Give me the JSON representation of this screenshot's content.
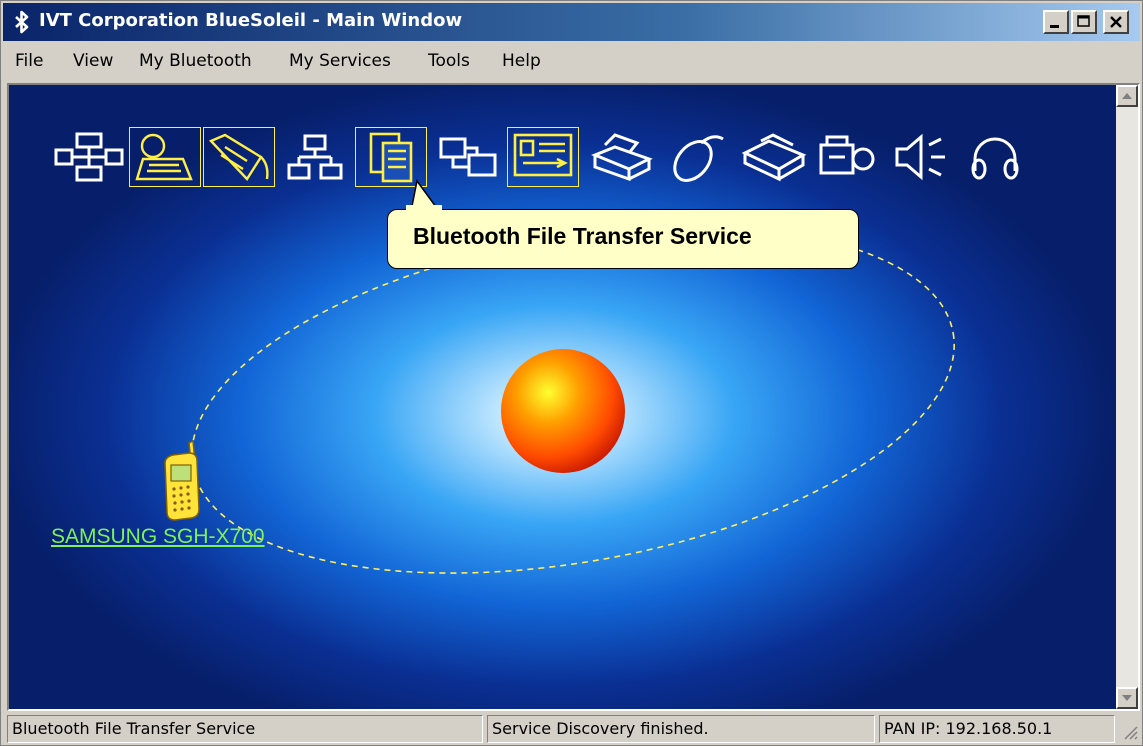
{
  "window": {
    "title": "IVT Corporation BlueSoleil - Main Window",
    "buttons": [
      "minimize",
      "maximize",
      "close"
    ]
  },
  "menu": [
    "File",
    "View",
    "My Bluetooth",
    "My Services",
    "Tools",
    "Help"
  ],
  "service_icons": [
    {
      "name": "network-access-icon",
      "highlighted": false
    },
    {
      "name": "dial-up-networking-icon",
      "highlighted": true
    },
    {
      "name": "serial-port-icon",
      "highlighted": true
    },
    {
      "name": "personal-area-network-icon",
      "highlighted": false
    },
    {
      "name": "file-transfer-icon",
      "highlighted": true
    },
    {
      "name": "synchronization-icon",
      "highlighted": false
    },
    {
      "name": "business-card-icon",
      "highlighted": true
    },
    {
      "name": "printer-icon",
      "highlighted": false
    },
    {
      "name": "mouse-icon",
      "highlighted": false
    },
    {
      "name": "fax-icon",
      "highlighted": false
    },
    {
      "name": "camera-icon",
      "highlighted": false
    },
    {
      "name": "audio-icon",
      "highlighted": false
    },
    {
      "name": "headset-icon",
      "highlighted": false
    }
  ],
  "tooltip": "Bluetooth File Transfer Service",
  "device": {
    "label": "SAMSUNG SGH-X700",
    "icon": "mobile-phone-icon"
  },
  "status": {
    "left": "Bluetooth File Transfer Service",
    "middle": "Service Discovery finished.",
    "right": "PAN IP: 192.168.50.1"
  },
  "colors": {
    "titlebar": "#0a246a",
    "highlight": "#ffee44",
    "device_label": "#7cf25a",
    "tooltip_bg": "#ffffc8",
    "orb": "#ff6600"
  }
}
